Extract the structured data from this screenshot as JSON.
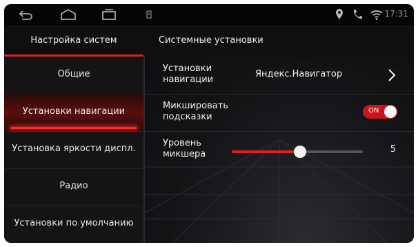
{
  "status_bar": {
    "time": "17:31",
    "icons": [
      "back-icon",
      "home-icon",
      "recents-icon",
      "storage-icon",
      "location-icon",
      "phone-icon",
      "wifi-icon"
    ]
  },
  "header": {
    "left_title": "Настройка систем",
    "right_title": "Системные установки"
  },
  "sidebar": {
    "items": [
      {
        "label": "Общие",
        "active": false
      },
      {
        "label": "Установки навигации",
        "active": true
      },
      {
        "label": "Установка яркости диспл.",
        "active": false
      },
      {
        "label": "Радио",
        "active": false
      },
      {
        "label": "Установки по умолчанию",
        "active": false
      }
    ]
  },
  "settings": {
    "navigation": {
      "label": "Установки навигации",
      "value": "Яндекс.Навигатор"
    },
    "mix_hints": {
      "label": "Микшировать подсказки",
      "toggle_text": "ON",
      "on": true
    },
    "mixer_level": {
      "label": "Уровень микшера",
      "value": "5",
      "fraction": 0.52
    }
  },
  "colors": {
    "accent": "#e02020",
    "background": "#0d0d0f"
  }
}
